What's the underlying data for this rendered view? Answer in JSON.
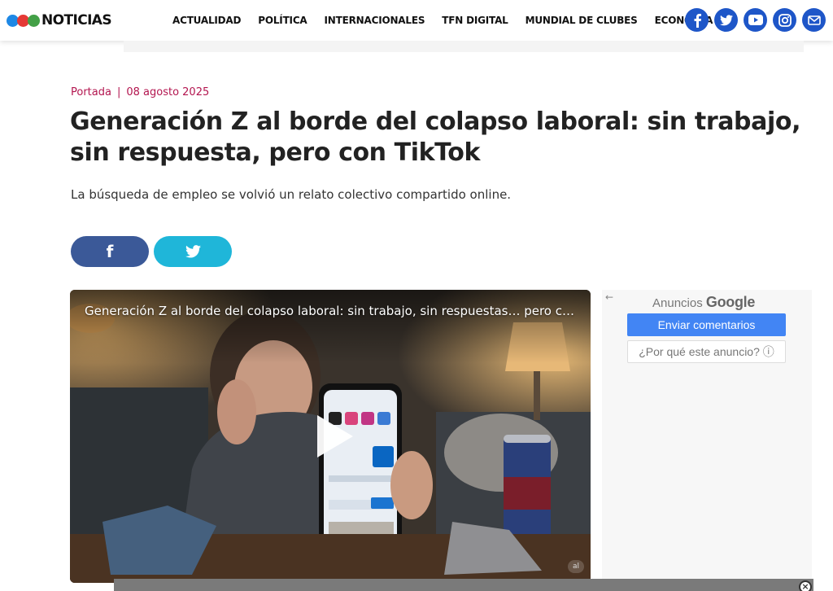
{
  "header": {
    "logo_text": "NOTICIAS",
    "logo_colors": [
      "#1e88e5",
      "#e53935",
      "#43a047"
    ],
    "nav": [
      "ACTUALIDAD",
      "POLÍTICA",
      "INTERNACIONALES",
      "TFN DIGITAL",
      "MUNDIAL DE CLUBES",
      "ECONOMÍA"
    ],
    "socials": [
      "facebook-icon",
      "twitter-icon",
      "youtube-icon",
      "instagram-icon",
      "mail-icon"
    ]
  },
  "article": {
    "section": "Portada",
    "separator": "|",
    "date": "08 agosto 2025",
    "title": "Generación Z al borde del colapso laboral: sin trabajo, sin respuesta, pero con TikTok",
    "subtitle": "La búsqueda de empleo se volvió un relato colectivo compartido online."
  },
  "share": {
    "facebook_label": "f",
    "twitter_icon": "twitter-icon"
  },
  "video": {
    "title": "Generación Z al borde del colapso laboral: sin trabajo, sin respuestas… pero c…",
    "badge": "al"
  },
  "ad": {
    "back_glyph": "←",
    "label": "Anuncios",
    "brand": "Google",
    "feedback_button": "Enviar comentarios",
    "why_button": "¿Por qué este anuncio? ⓘ"
  },
  "bottom": {
    "close_glyph": "×"
  }
}
